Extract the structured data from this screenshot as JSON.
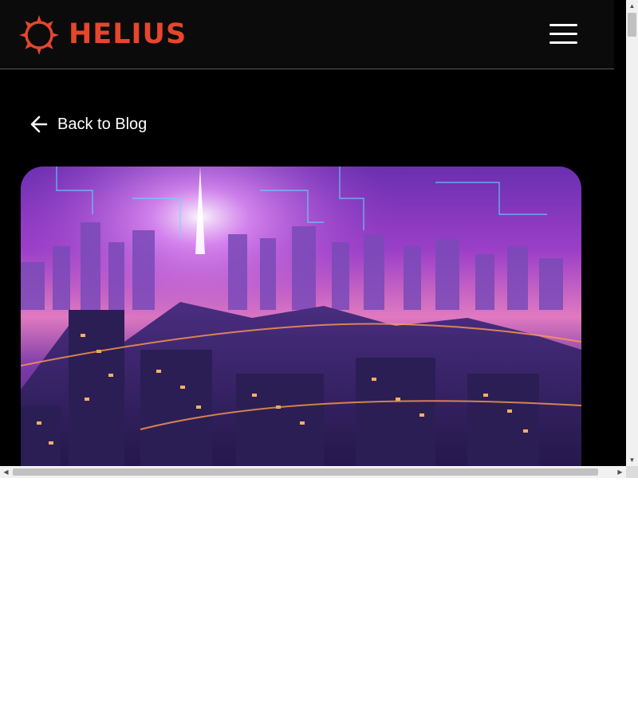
{
  "brand": {
    "name": "HELIUS",
    "color": "#e8452c",
    "logo_icon": "sun-ring-icon"
  },
  "header": {
    "menu_icon": "hamburger-menu-icon",
    "menu_label": "Menu"
  },
  "back_link": {
    "label": "Back to Blog",
    "icon": "arrow-left-icon"
  },
  "hero": {
    "image_description_icon": "cyberpunk-city-illustration"
  },
  "colors": {
    "page_background": "#000000",
    "navbar_background": "#0b0b0b",
    "text": "#ffffff",
    "accent": "#e8452c"
  }
}
